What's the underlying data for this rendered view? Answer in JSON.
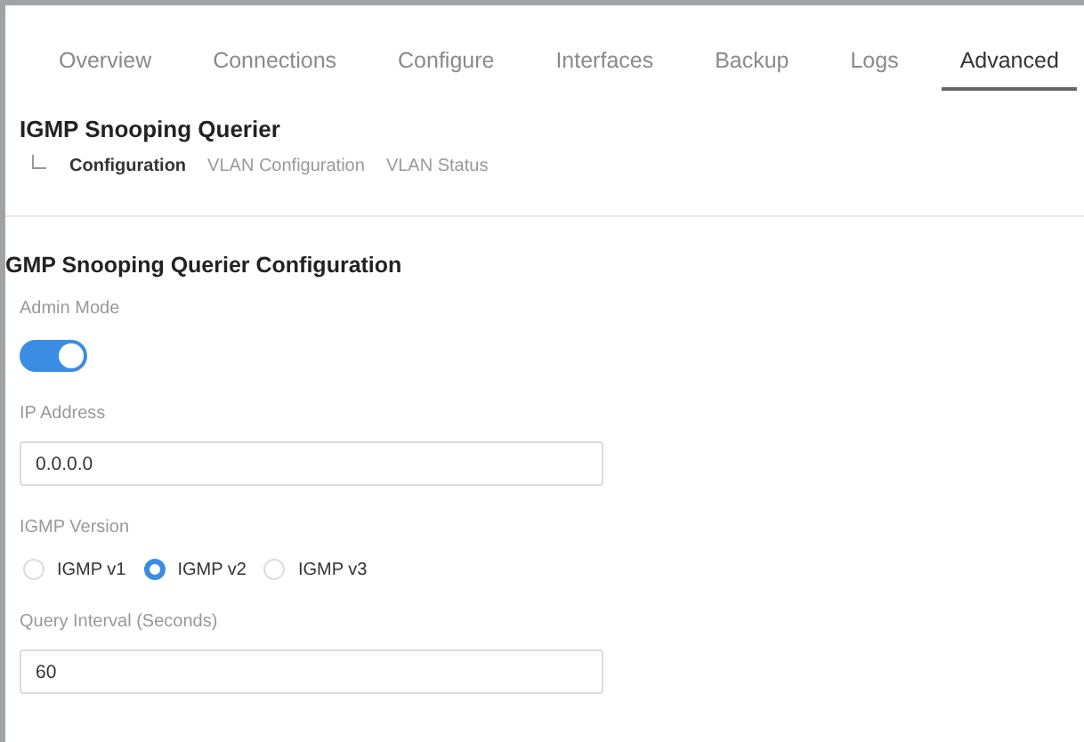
{
  "tabs": [
    {
      "label": "Overview",
      "selected": false
    },
    {
      "label": "Connections",
      "selected": false
    },
    {
      "label": "Configure",
      "selected": false
    },
    {
      "label": "Interfaces",
      "selected": false
    },
    {
      "label": "Backup",
      "selected": false
    },
    {
      "label": "Logs",
      "selected": false
    },
    {
      "label": "Advanced",
      "selected": true
    }
  ],
  "page_title": "IGMP Snooping Querier",
  "subnav": [
    {
      "label": "Configuration",
      "selected": true
    },
    {
      "label": "VLAN Configuration",
      "selected": false
    },
    {
      "label": "VLAN Status",
      "selected": false
    }
  ],
  "section_title": "GMP Snooping Querier Configuration",
  "admin_mode": {
    "label": "Admin Mode",
    "on": true
  },
  "ip_address": {
    "label": "IP Address",
    "value": "0.0.0.0"
  },
  "igmp_version": {
    "label": "IGMP Version",
    "options": [
      {
        "label": "IGMP v1",
        "selected": false
      },
      {
        "label": "IGMP v2",
        "selected": true
      },
      {
        "label": "IGMP v3",
        "selected": false
      }
    ]
  },
  "query_interval": {
    "label": "Query Interval (Seconds)",
    "value": "60"
  }
}
